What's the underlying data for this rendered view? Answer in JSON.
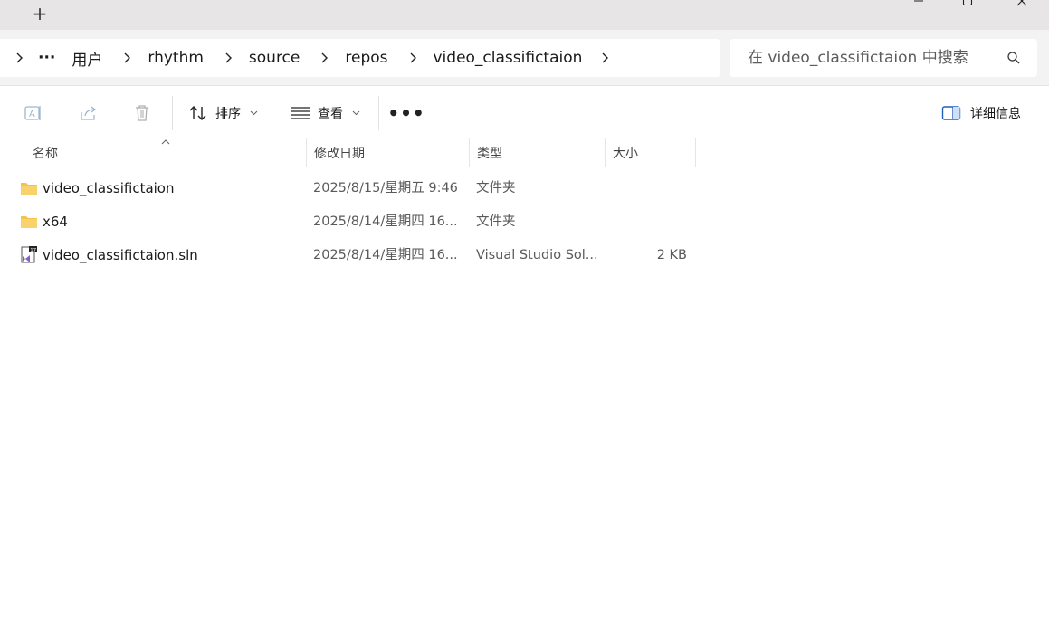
{
  "window": {
    "new_tab_label": "+",
    "controls": [
      "minimize",
      "maximize",
      "close"
    ]
  },
  "address": {
    "overflow_label": "···",
    "breadcrumb": [
      "用户",
      "rhythm",
      "source",
      "repos",
      "video_classifictaion"
    ]
  },
  "search": {
    "placeholder": "在 video_classifictaion 中搜索"
  },
  "toolbar": {
    "sort_label": "排序",
    "view_label": "查看",
    "more_label": "•••",
    "details_label": "详细信息"
  },
  "columns": {
    "name": "名称",
    "date": "修改日期",
    "type": "类型",
    "size": "大小"
  },
  "files": [
    {
      "name": "video_classifictaion",
      "date": "2025/8/15/星期五 9:46",
      "type": "文件夹",
      "size": "",
      "icon": "folder-icon"
    },
    {
      "name": "x64",
      "date": "2025/8/14/星期四 16...",
      "type": "文件夹",
      "size": "",
      "icon": "folder-icon"
    },
    {
      "name": "video_classifictaion.sln",
      "date": "2025/8/14/星期四 16...",
      "type": "Visual Studio Sol...",
      "size": "2 KB",
      "icon": "visual-studio-solution-icon"
    }
  ],
  "colors": {
    "tab_strip": "#e7e5e6",
    "address_row": "#f3f3f3",
    "folder_yellow": "#f5c24c",
    "vs_purple": "#8661c5"
  }
}
